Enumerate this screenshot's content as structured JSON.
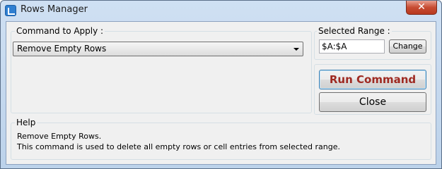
{
  "window": {
    "title": "Rows Manager",
    "close_glyph": "✕"
  },
  "command_group": {
    "label": "Command to Apply :",
    "selected_command": "Remove Empty Rows"
  },
  "range_group": {
    "label": "Selected Range :",
    "range_value": "$A:$A",
    "change_label": "Change"
  },
  "actions": {
    "run_label": "Run Command",
    "close_label": "Close"
  },
  "help": {
    "label": "Help",
    "line1": "Remove Empty Rows.",
    "line2": "This command is used to delete all empty rows or cell entries from selected range."
  },
  "colors": {
    "run_text": "#9e2a22",
    "title_bar": "#cfe0f3",
    "client_bg": "#f0f0f0"
  }
}
